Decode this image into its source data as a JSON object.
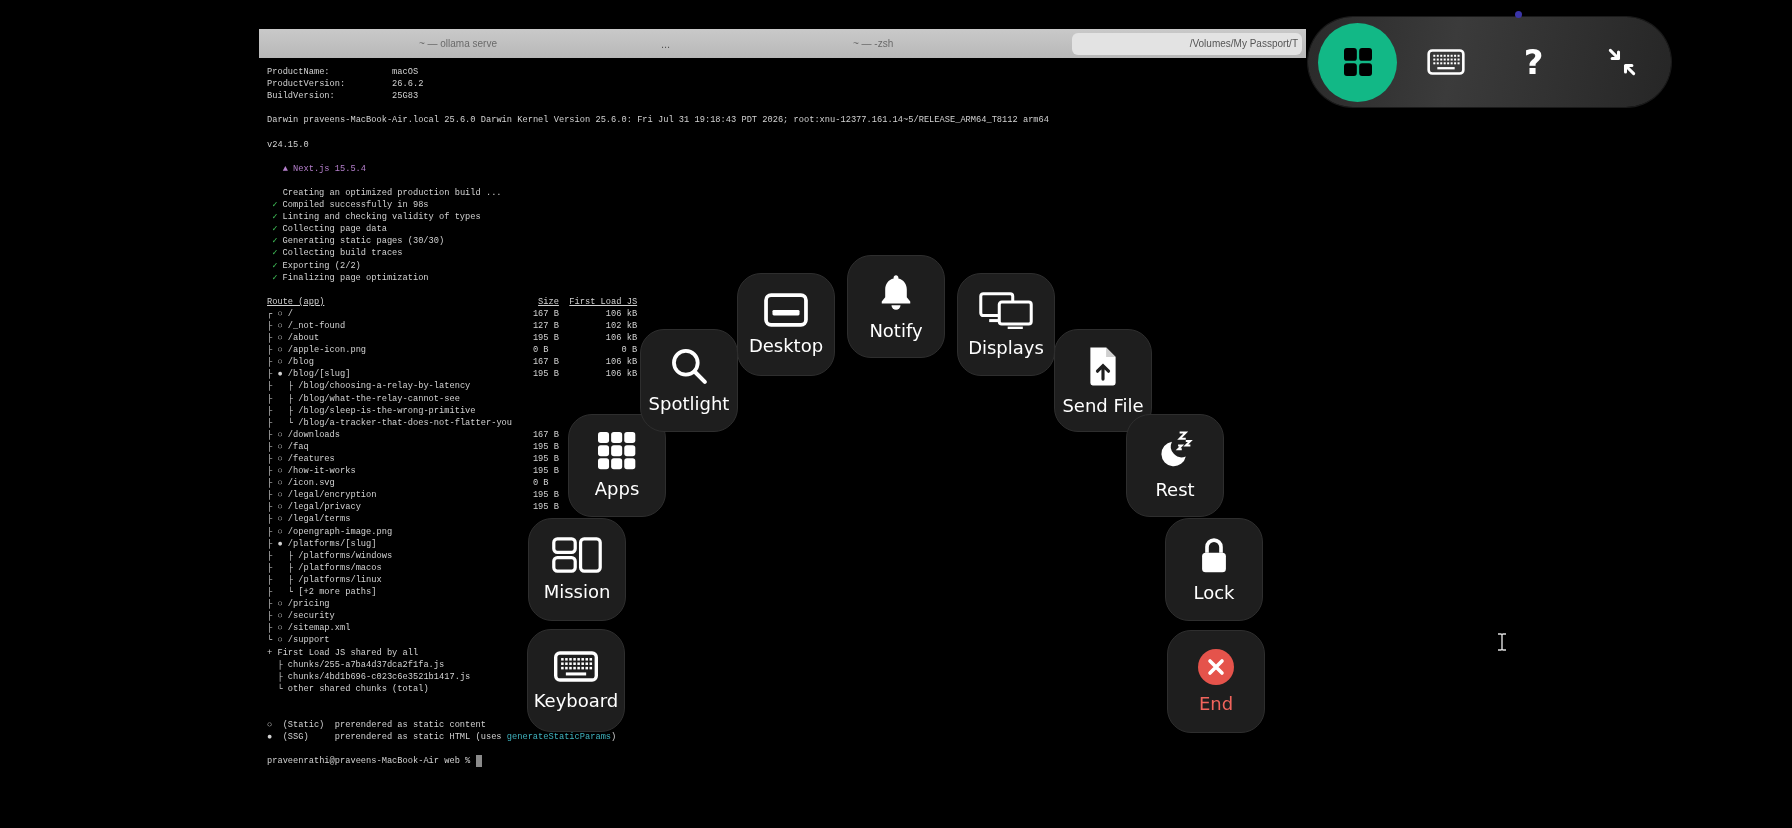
{
  "terminal": {
    "tabs": [
      {
        "title": "~ — ollama serve",
        "selected": false
      },
      {
        "title": "~ — -zsh",
        "selected": false
      },
      {
        "title": "/Volumes/My Passport/T",
        "selected": true
      }
    ],
    "tab_overflow": "...",
    "system_info": [
      {
        "key": "ProductName:",
        "value": "macOS"
      },
      {
        "key": "ProductVersion:",
        "value": "26.6.2"
      },
      {
        "key": "BuildVersion:",
        "value": "25G83"
      }
    ],
    "kernel": "Darwin praveens-MacBook-Air.local 25.6.0 Darwin Kernel Version 25.6.0: Fri Jul 31 19:18:43 PDT 2026; root:xnu-12377.161.14~5/RELEASE_ARM64_T8112 arm64",
    "node_version": "v24.15.0",
    "banner": "▲ Next.js 15.5.4",
    "build_steps": [
      {
        "kind": "info",
        "text": "Creating an optimized production build ..."
      },
      {
        "kind": "check",
        "mark": "✓",
        "text": "Compiled successfully in 98s"
      },
      {
        "kind": "check",
        "mark": "✓",
        "text": "Linting and checking validity of types"
      },
      {
        "kind": "check",
        "mark": "✓",
        "text": "Collecting page data"
      },
      {
        "kind": "check",
        "mark": "✓",
        "text": "Generating static pages (30/30)"
      },
      {
        "kind": "check",
        "mark": "✓",
        "text": "Collecting build traces"
      },
      {
        "kind": "check",
        "mark": "✓",
        "text": "Exporting (2/2)"
      },
      {
        "kind": "check",
        "mark": "✓",
        "text": "Finalizing page optimization"
      }
    ],
    "routes": {
      "header": {
        "route": "Route (app)",
        "size": "Size",
        "first_load": "First Load JS"
      },
      "rows": [
        {
          "kind": "route",
          "route": "┌ ○ /",
          "size": "167 B",
          "first_load": "106 kB"
        },
        {
          "kind": "route",
          "route": "├ ○ /_not-found",
          "size": "127 B",
          "first_load": "102 kB"
        },
        {
          "kind": "route",
          "route": "├ ○ /about",
          "size": "195 B",
          "first_load": "106 kB"
        },
        {
          "kind": "route",
          "route": "├ ○ /apple-icon.png",
          "size": "0 B",
          "first_load": "0 B"
        },
        {
          "kind": "route",
          "route": "├ ○ /blog",
          "size": "167 B",
          "first_load": "106 kB"
        },
        {
          "kind": "route",
          "route": "├ ● /blog/[slug]",
          "size": "195 B",
          "first_load": "106 kB"
        },
        {
          "kind": "route",
          "route": "├   ├ /blog/choosing-a-relay-by-latency"
        },
        {
          "kind": "route",
          "route": "├   ├ /blog/what-the-relay-cannot-see"
        },
        {
          "kind": "route",
          "route": "├   ├ /blog/sleep-is-the-wrong-primitive"
        },
        {
          "kind": "route",
          "route": "├   └ /blog/a-tracker-that-does-not-flatter-you"
        },
        {
          "kind": "route",
          "route": "├ ○ /downloads",
          "size": "167 B"
        },
        {
          "kind": "route",
          "route": "├ ○ /faq",
          "size": "195 B"
        },
        {
          "kind": "route",
          "route": "├ ○ /features",
          "size": "195 B"
        },
        {
          "kind": "route",
          "route": "├ ○ /how-it-works",
          "size": "195 B"
        },
        {
          "kind": "route",
          "route": "├ ○ /icon.svg",
          "size": "0 B"
        },
        {
          "kind": "route",
          "route": "├ ○ /legal/encryption",
          "size": "195 B"
        },
        {
          "kind": "route",
          "route": "├ ○ /legal/privacy",
          "size": "195 B"
        },
        {
          "kind": "route",
          "route": "├ ○ /legal/terms"
        },
        {
          "kind": "route",
          "route": "├ ○ /opengraph-image.png"
        },
        {
          "kind": "route",
          "route": "├ ● /platforms/[slug]"
        },
        {
          "kind": "route",
          "route": "├   ├ /platforms/windows"
        },
        {
          "kind": "route",
          "route": "├   ├ /platforms/macos"
        },
        {
          "kind": "route",
          "route": "├   ├ /platforms/linux"
        },
        {
          "kind": "route",
          "route": "├   └ [+2 more paths]"
        },
        {
          "kind": "route",
          "route": "├ ○ /pricing"
        },
        {
          "kind": "route",
          "route": "├ ○ /security"
        },
        {
          "kind": "route",
          "route": "├ ○ /sitemap.xml"
        },
        {
          "kind": "route",
          "route": "└ ○ /support"
        },
        {
          "kind": "route",
          "route": "+ First Load JS shared by all"
        },
        {
          "kind": "chunk",
          "route": "├ chunks/255-a7ba4d37dca2f1fa.js"
        },
        {
          "kind": "chunk",
          "route": "├ chunks/4bd1b696-c023c6e3521b1417.js"
        },
        {
          "kind": "chunk",
          "route": "└ other shared chunks (total)"
        }
      ]
    },
    "legend": [
      {
        "symbol": "○",
        "label": "(Static)",
        "parts": [
          {
            "text": "prerendered as static content"
          }
        ]
      },
      {
        "symbol": "●",
        "label": "(SSG)",
        "parts": [
          {
            "text": "prerendered as static HTML (uses "
          },
          {
            "kind": "code",
            "text": "generateStaticParams"
          },
          {
            "text": ")"
          }
        ]
      }
    ],
    "prompt": "praveenrathi@praveens-MacBook-Air web %"
  },
  "toolbar": [
    {
      "kind": "grid",
      "selected": true
    },
    {
      "kind": "keyboard",
      "selected": false
    },
    {
      "kind": "help",
      "label": "?",
      "selected": false
    },
    {
      "kind": "collapse",
      "selected": false
    }
  ],
  "actions": [
    {
      "label": "Keyboard",
      "kind": "keyboard"
    },
    {
      "label": "Mission",
      "kind": "mission"
    },
    {
      "label": "Apps",
      "kind": "apps"
    },
    {
      "label": "Spotlight",
      "kind": "search"
    },
    {
      "label": "Desktop",
      "kind": "desktop"
    },
    {
      "label": "Notify",
      "kind": "notify"
    },
    {
      "label": "Displays",
      "kind": "displays"
    },
    {
      "label": "Send File",
      "kind": "send"
    },
    {
      "label": "Rest",
      "kind": "rest"
    },
    {
      "label": "Lock",
      "kind": "lock"
    },
    {
      "label": "End",
      "kind": "end"
    }
  ]
}
